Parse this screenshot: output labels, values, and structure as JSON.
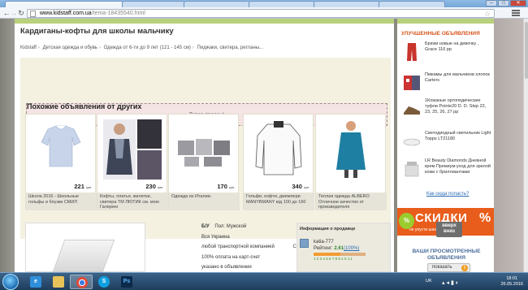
{
  "browser": {
    "url_host": "www.kidstaff.com.ua",
    "url_path": "/tema-18435540.html",
    "tab_partial_text": "Подобрать ..."
  },
  "page": {
    "title": "Кардиганы-кофты для школы мальчику",
    "breadcrumb": [
      "Kidstaff",
      "Детская одежда и обувь",
      "Одежда от 6-ти до 9 лет (121 - 145 см)",
      "Пиджаки, свитера, регланы..."
    ],
    "sold_notice": "Товар продан!",
    "similar_title": "Похожие объявления от других",
    "similar": [
      {
        "price": "221",
        "unit": "грн.",
        "caption": "Школа 2016 - Школьные гольфы и блузки СМИЛ"
      },
      {
        "price": "230",
        "unit": "грн.",
        "caption": "Кофты, платья, жилетки, свитера ТМ ЛЮТИК см. мою Галерею"
      },
      {
        "price": "170",
        "unit": "грн.",
        "caption": "Одежда из Италии."
      },
      {
        "price": "340",
        "unit": "грн.",
        "caption": "Гольфи, кофти, джемпери MANYBMANY від 100 до 160"
      },
      {
        "price": "",
        "unit": "",
        "caption": "Теплая одежда ALBERO Отличное качество от производителя"
      }
    ],
    "specs": [
      {
        "key": "Состояние:",
        "value": "Б/У",
        "extra_key": "Пол:",
        "extra_value": "Мужской"
      },
      {
        "key": "Доставка",
        "value": "Вся Украина"
      },
      {
        "key": "Способ доставки",
        "value": "любой транспортной компанией"
      },
      {
        "key": "Оплата",
        "value": "100% оплата на карт-счет"
      },
      {
        "key": "Возврат",
        "value": "указано в объявлении"
      }
    ],
    "seller": {
      "header": "Информация о продавце",
      "name": "katia-777",
      "rating_label": "Рейтинг:",
      "rating_value": "2.61",
      "rating_pct": "(100%)",
      "rating_fraction": 0.52,
      "scale": "1234567891011"
    }
  },
  "sidebar": {
    "title": "УЛУЧШЕННЫЕ ОБЪЯВЛЕНИЯ",
    "ads": [
      {
        "text": "Брюки новые на девочку , Grace 116 рр"
      },
      {
        "text": "Пижамы для мальчиков хлопок Carters"
      },
      {
        "text": "1Кожаные ортопедические туфли Pointe20 D. D. Step 22, 23, 25, 26, 27 рр"
      },
      {
        "text": "Светодиодный светильник Light Topps LT21180"
      },
      {
        "text": "LR Beauty Diamonds Дневной крем Премиум-уход для зрелой кожи с бриллиантами"
      }
    ],
    "how_link": "Как сюда попасть?",
    "banner_big": "СКИДКИ",
    "banner_small": "не упусти шанс купить",
    "banner_pct": "%",
    "viewed_title": "ВАШИ ПРОСМОТРЕННЫЕ ОБЪЯВЛЕНИЯ",
    "show_label": "показать",
    "show_count": "5"
  },
  "overlay": {
    "up_label": "вверх",
    "down_label": "вниз"
  },
  "taskbar": {
    "lang": "UK",
    "time": "18:01",
    "date": "26.05.2016"
  }
}
